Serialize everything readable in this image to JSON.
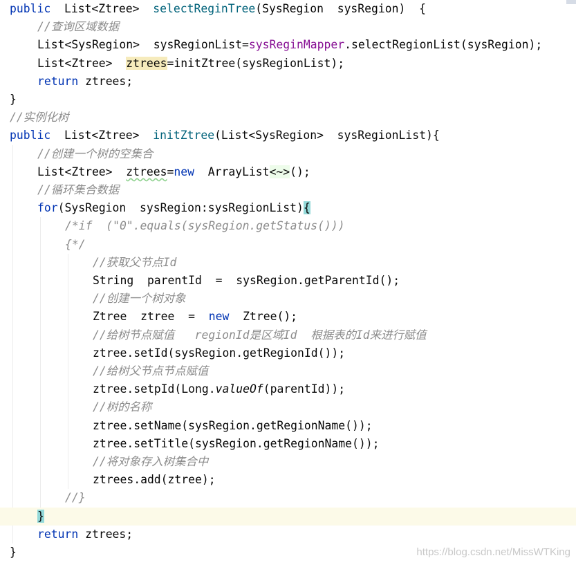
{
  "editor": {
    "lines": [
      {
        "indent": 0,
        "segs": [
          [
            "kw",
            "public"
          ],
          [
            "",
            "  List<Ztree>  "
          ],
          [
            "fn",
            "selectReginTree"
          ],
          [
            "",
            "(SysRegion  sysRegion)  {"
          ]
        ]
      },
      {
        "indent": 1,
        "segs": [
          [
            "cm",
            "//查询区域数据"
          ]
        ]
      },
      {
        "indent": 1,
        "segs": [
          [
            "",
            "List<SysRegion>  sysRegionList="
          ],
          [
            "fld",
            "sysReginMapper"
          ],
          [
            "",
            ".selectRegionList(sysRegion);"
          ]
        ]
      },
      {
        "indent": 1,
        "segs": [
          [
            "",
            "List<Ztree>  "
          ],
          [
            "hl",
            "ztrees"
          ],
          [
            "",
            "=initZtree(sysRegionList);"
          ]
        ]
      },
      {
        "indent": 1,
        "segs": [
          [
            "kw",
            "return"
          ],
          [
            "",
            " ztrees;"
          ]
        ]
      },
      {
        "indent": 0,
        "segs": [
          [
            "",
            "}"
          ]
        ]
      },
      {
        "indent": 0,
        "segs": [
          [
            "cm",
            "//实例化树"
          ]
        ]
      },
      {
        "indent": 0,
        "segs": [
          [
            "kw",
            "public"
          ],
          [
            "",
            "  List<Ztree>  "
          ],
          [
            "fn",
            "initZtree"
          ],
          [
            "",
            "(List<SysRegion>  sysRegionList){"
          ]
        ]
      },
      {
        "indent": 1,
        "segs": [
          [
            "cm",
            "//创建一个树的空集合"
          ]
        ]
      },
      {
        "indent": 1,
        "segs": [
          [
            "",
            "List<Ztree>  "
          ],
          [
            "uw",
            "ztrees"
          ],
          [
            "",
            "="
          ],
          [
            "kw",
            "new"
          ],
          [
            "",
            "  ArrayList"
          ],
          [
            "diam",
            "<~>"
          ],
          [
            "",
            "();"
          ]
        ]
      },
      {
        "indent": 1,
        "segs": [
          [
            "cm",
            "//循环集合数据"
          ]
        ]
      },
      {
        "indent": 1,
        "segs": [
          [
            "kw",
            "for"
          ],
          [
            "",
            "(SysRegion  sysRegion:sysRegionList)"
          ],
          [
            "br",
            "{"
          ]
        ]
      },
      {
        "indent": 2,
        "segs": [
          [
            "cm",
            "/*if  (\"0\".equals(sysRegion.getStatus()))"
          ]
        ]
      },
      {
        "indent": 2,
        "segs": [
          [
            "cm",
            "{*/"
          ]
        ]
      },
      {
        "indent": 3,
        "segs": [
          [
            "cm",
            "//获取父节点Id"
          ]
        ]
      },
      {
        "indent": 3,
        "segs": [
          [
            "",
            "String  parentId  =  sysRegion.getParentId();"
          ]
        ]
      },
      {
        "indent": 3,
        "segs": [
          [
            "cm",
            "//创建一个树对象"
          ]
        ]
      },
      {
        "indent": 3,
        "segs": [
          [
            "",
            "Ztree  ztree  =  "
          ],
          [
            "kw",
            "new"
          ],
          [
            "",
            "  Ztree();"
          ]
        ]
      },
      {
        "indent": 3,
        "segs": [
          [
            "cm",
            "//给树节点赋值   regionId是区域Id  根据表的Id来进行赋值"
          ]
        ]
      },
      {
        "indent": 3,
        "segs": [
          [
            "",
            "ztree.setId(sysRegion.getRegionId());"
          ]
        ]
      },
      {
        "indent": 3,
        "segs": [
          [
            "cm",
            "//给树父节点节点赋值"
          ]
        ]
      },
      {
        "indent": 3,
        "segs": [
          [
            "",
            "ztree.setpId(Long."
          ],
          [
            "it",
            "valueOf"
          ],
          [
            "",
            "(parentId));"
          ]
        ]
      },
      {
        "indent": 3,
        "segs": [
          [
            "cm",
            "//树的名称"
          ]
        ]
      },
      {
        "indent": 3,
        "segs": [
          [
            "",
            "ztree.setName(sysRegion.getRegionName());"
          ]
        ]
      },
      {
        "indent": 3,
        "segs": [
          [
            "",
            "ztree.setTitle(sysRegion.getRegionName());"
          ]
        ]
      },
      {
        "indent": 3,
        "segs": [
          [
            "cm",
            "//将对象存入树集合中"
          ]
        ]
      },
      {
        "indent": 3,
        "segs": [
          [
            "",
            "ztrees.add(ztree);"
          ]
        ]
      },
      {
        "indent": 2,
        "segs": [
          [
            "cm",
            "//}"
          ]
        ]
      },
      {
        "indent": 1,
        "current": true,
        "segs": [
          [
            "br",
            "}"
          ]
        ]
      },
      {
        "indent": 1,
        "segs": [
          [
            "kw",
            "return"
          ],
          [
            "",
            " ztrees;"
          ]
        ]
      },
      {
        "indent": 0,
        "segs": [
          [
            "",
            "}"
          ]
        ]
      }
    ]
  },
  "watermark": "https://blog.csdn.net/MissWTKing"
}
